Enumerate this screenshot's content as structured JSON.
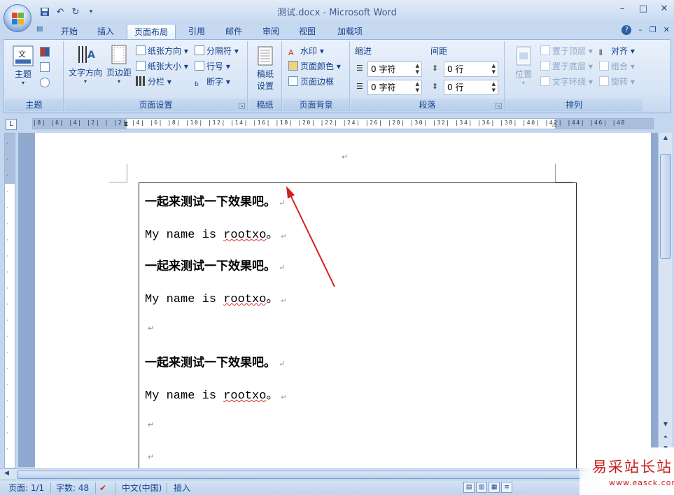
{
  "window": {
    "title": "测试.docx - Microsoft Word",
    "controls": [
      "minimize-icon",
      "maximize-icon",
      "close-icon"
    ]
  },
  "qat": {
    "items": [
      "save-icon",
      "undo-icon",
      "redo-icon",
      "customize-icon"
    ]
  },
  "tabs": [
    "开始",
    "插入",
    "页面布局",
    "引用",
    "邮件",
    "审阅",
    "视图",
    "加载项"
  ],
  "active_tab": "页面布局",
  "ribbon": {
    "theme": {
      "label": "主题",
      "btn": "主题"
    },
    "page_setup": {
      "label": "页面设置",
      "text_direction": "文字方向",
      "margins": "页边距",
      "orientation": "纸张方向",
      "size": "纸张大小",
      "columns": "分栏",
      "breaks": "分隔符",
      "line_numbers": "行号",
      "hyphenation": "断字"
    },
    "manuscript": {
      "label": "稿纸",
      "btn1": "稿纸",
      "btn2": "设置"
    },
    "page_background": {
      "label": "页面背景",
      "watermark": "水印",
      "page_color": "页面颜色",
      "page_borders": "页面边框"
    },
    "paragraph": {
      "label": "段落",
      "indent": "缩进",
      "spacing": "间距",
      "indent_left": "0 字符",
      "indent_right": "0 字符",
      "spacing_before": "0 行",
      "spacing_after": "0 行"
    },
    "arrange": {
      "label": "排列",
      "position": "位置",
      "bring_front": "置于顶层",
      "send_back": "置于底层",
      "text_wrap": "文字环绕",
      "align": "对齐",
      "group": "组合",
      "rotate": "旋转"
    }
  },
  "ruler": {
    "numbers": "|8| |6| |4| |2| | |2| |4| |6| |8| |10| |12| |14| |16| |18| |20| |22| |24| |26| |28| |30| |32| |34| |36| |38| |40| |42| |44| |46| |48"
  },
  "document": {
    "paragraph_mark": "↵",
    "lines": [
      {
        "type": "zh",
        "text": "一起来测试一下效果吧。"
      },
      {
        "type": "en",
        "pre": "My name is ",
        "squiggle": "rootxo",
        "post": "。"
      },
      {
        "type": "zh",
        "text": "一起来测试一下效果吧。"
      },
      {
        "type": "en",
        "pre": "My name is ",
        "squiggle": "rootxo",
        "post": "。"
      },
      {
        "type": "empty"
      },
      {
        "type": "zh",
        "text": "一起来测试一下效果吧。"
      },
      {
        "type": "en",
        "pre": "My name is ",
        "squiggle": "rootxo",
        "post": "。"
      },
      {
        "type": "empty"
      },
      {
        "type": "empty"
      }
    ]
  },
  "status": {
    "page": "页面: 1/1",
    "words": "字数: 48",
    "language": "中文(中国)",
    "mode": "插入"
  },
  "watermark": {
    "cn": "易采站长站",
    "url": "www.easck.com"
  },
  "colors": {
    "accent": "#15428b",
    "annotation_arrow": "#d42020",
    "spell_error": "#e03030"
  }
}
